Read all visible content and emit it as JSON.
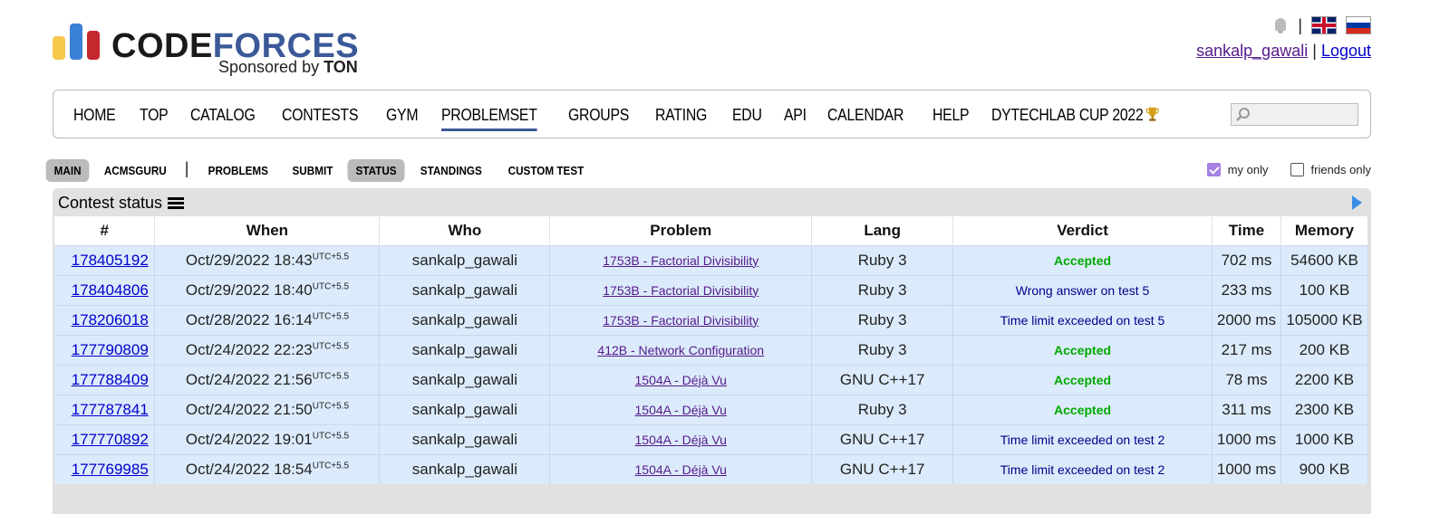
{
  "logo": {
    "title_a": "CODE",
    "title_b": "FORCES",
    "sponsored_prefix": "Sponsored by",
    "sponsor": "TON",
    "bar_colors": [
      "#f5c84c",
      "#3a80d5",
      "#c6262e"
    ]
  },
  "header": {
    "separator": "|",
    "username": "sankalp_gawali",
    "logout": "Logout"
  },
  "nav": {
    "items": [
      "HOME",
      "TOP",
      "CATALOG",
      "CONTESTS",
      "GYM",
      "PROBLEMSET",
      "GROUPS",
      "RATING",
      "EDU",
      "API",
      "CALENDAR",
      "HELP",
      "DYTECHLAB CUP 2022"
    ],
    "active": "PROBLEMSET"
  },
  "second_menu": {
    "items": [
      "MAIN",
      "ACMSGURU",
      "PROBLEMS",
      "SUBMIT",
      "STATUS",
      "STANDINGS",
      "CUSTOM TEST"
    ],
    "separator": "|"
  },
  "filters": {
    "my_only": "my only",
    "friends_only": "friends only"
  },
  "status": {
    "title": "Contest status",
    "columns": [
      "#",
      "When",
      "Who",
      "Problem",
      "Lang",
      "Verdict",
      "Time",
      "Memory"
    ],
    "rows": [
      {
        "id": "178405192",
        "when": "Oct/29/2022 18:43",
        "tz": "UTC+5.5",
        "who": "sankalp_gawali",
        "problem": "1753B - Factorial Divisibility",
        "lang": "Ruby 3",
        "verdict": "Accepted",
        "ok": true,
        "time": "702 ms",
        "memory": "54600 KB"
      },
      {
        "id": "178404806",
        "when": "Oct/29/2022 18:40",
        "tz": "UTC+5.5",
        "who": "sankalp_gawali",
        "problem": "1753B - Factorial Divisibility",
        "lang": "Ruby 3",
        "verdict": "Wrong answer on test 5",
        "ok": false,
        "time": "233 ms",
        "memory": "100 KB"
      },
      {
        "id": "178206018",
        "when": "Oct/28/2022 16:14",
        "tz": "UTC+5.5",
        "who": "sankalp_gawali",
        "problem": "1753B - Factorial Divisibility",
        "lang": "Ruby 3",
        "verdict": "Time limit exceeded on test 5",
        "ok": false,
        "time": "2000 ms",
        "memory": "105000 KB"
      },
      {
        "id": "177790809",
        "when": "Oct/24/2022 22:23",
        "tz": "UTC+5.5",
        "who": "sankalp_gawali",
        "problem": "412B - Network Configuration",
        "lang": "Ruby 3",
        "verdict": "Accepted",
        "ok": true,
        "time": "217 ms",
        "memory": "200 KB"
      },
      {
        "id": "177788409",
        "when": "Oct/24/2022 21:56",
        "tz": "UTC+5.5",
        "who": "sankalp_gawali",
        "problem": "1504A - Déjà Vu",
        "lang": "GNU C++17",
        "verdict": "Accepted",
        "ok": true,
        "time": "78 ms",
        "memory": "2200 KB"
      },
      {
        "id": "177787841",
        "when": "Oct/24/2022 21:50",
        "tz": "UTC+5.5",
        "who": "sankalp_gawali",
        "problem": "1504A - Déjà Vu",
        "lang": "Ruby 3",
        "verdict": "Accepted",
        "ok": true,
        "time": "311 ms",
        "memory": "2300 KB"
      },
      {
        "id": "177770892",
        "when": "Oct/24/2022 19:01",
        "tz": "UTC+5.5",
        "who": "sankalp_gawali",
        "problem": "1504A - Déjà Vu",
        "lang": "GNU C++17",
        "verdict": "Time limit exceeded on test 2",
        "ok": false,
        "time": "1000 ms",
        "memory": "1000 KB"
      },
      {
        "id": "177769985",
        "when": "Oct/24/2022 18:54",
        "tz": "UTC+5.5",
        "who": "sankalp_gawali",
        "problem": "1504A - Déjà Vu",
        "lang": "GNU C++17",
        "verdict": "Time limit exceeded on test 2",
        "ok": false,
        "time": "1000 ms",
        "memory": "900 KB"
      }
    ]
  }
}
